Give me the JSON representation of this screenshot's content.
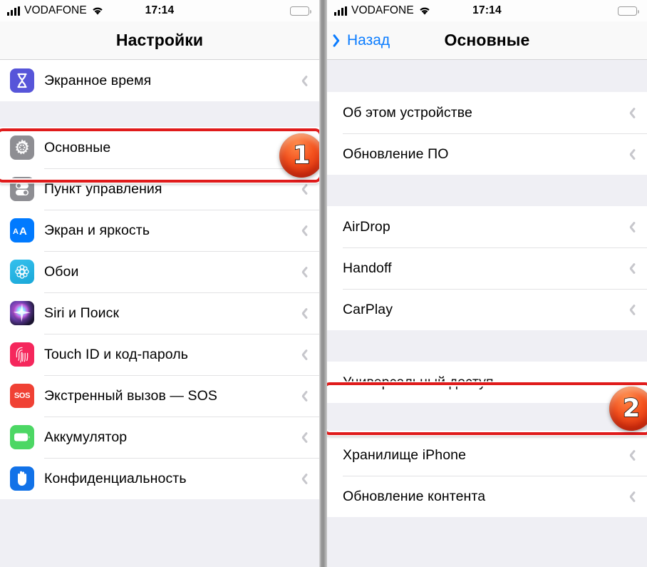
{
  "colors": {
    "accent_blue": "#0a7cff",
    "highlight_red": "#e01b1b",
    "badge_orange": "#f4521e",
    "list_bg": "#efeff4",
    "row_bg": "#ffffff"
  },
  "left_phone": {
    "status_bar": {
      "carrier": "VODAFONE",
      "time": "17:14",
      "signal_icon": "signal-bars-icon",
      "wifi_icon": "wifi-icon",
      "battery_icon": "battery-icon"
    },
    "nav": {
      "title": "Настройки"
    },
    "groups": [
      {
        "rows": [
          {
            "label": "Экранное время",
            "icon": "hourglass-icon",
            "icon_class": "ico-screentime",
            "glyph": "⧗"
          }
        ]
      },
      {
        "rows": [
          {
            "label": "Основные",
            "icon": "gear-icon",
            "icon_class": "ico-general",
            "glyph": "✿"
          },
          {
            "label": "Пункт управления",
            "icon": "toggles-icon",
            "icon_class": "ico-control",
            "glyph": ""
          },
          {
            "label": "Экран и яркость",
            "icon": "text-size-icon",
            "icon_class": "ico-display",
            "glyph": "AA"
          },
          {
            "label": "Обои",
            "icon": "flower-icon",
            "icon_class": "ico-wallpaper",
            "glyph": "✺"
          },
          {
            "label": "Siri и Поиск",
            "icon": "siri-icon",
            "icon_class": "ico-siri",
            "glyph": ""
          },
          {
            "label": "Touch ID и код-пароль",
            "icon": "fingerprint-icon",
            "icon_class": "ico-touchid",
            "glyph": ""
          },
          {
            "label": "Экстренный вызов — SOS",
            "icon": "sos-icon",
            "icon_class": "ico-sos",
            "glyph": "SOS"
          },
          {
            "label": "Аккумулятор",
            "icon": "battery-icon",
            "icon_class": "ico-battery",
            "glyph": ""
          },
          {
            "label": "Конфиденциальность",
            "icon": "hand-icon",
            "icon_class": "ico-privacy",
            "glyph": "✋"
          }
        ]
      }
    ],
    "highlight": {
      "step": "1",
      "target_label": "Основные"
    }
  },
  "right_phone": {
    "status_bar": {
      "carrier": "VODAFONE",
      "time": "17:14",
      "signal_icon": "signal-bars-icon",
      "wifi_icon": "wifi-icon",
      "battery_icon": "battery-icon"
    },
    "nav": {
      "back_label": "Назад",
      "title": "Основные",
      "back_icon": "chevron-left-icon"
    },
    "groups": [
      {
        "rows": [
          {
            "label": "Об этом устройстве"
          },
          {
            "label": "Обновление ПО"
          }
        ]
      },
      {
        "rows": [
          {
            "label": "AirDrop"
          },
          {
            "label": "Handoff"
          },
          {
            "label": "CarPlay"
          }
        ]
      },
      {
        "rows": [
          {
            "label": "Универсальный доступ"
          }
        ]
      },
      {
        "rows": [
          {
            "label": "Хранилище iPhone"
          },
          {
            "label": "Обновление контента"
          }
        ]
      }
    ],
    "highlight": {
      "step": "2",
      "target_label": "Универсальный доступ"
    }
  }
}
